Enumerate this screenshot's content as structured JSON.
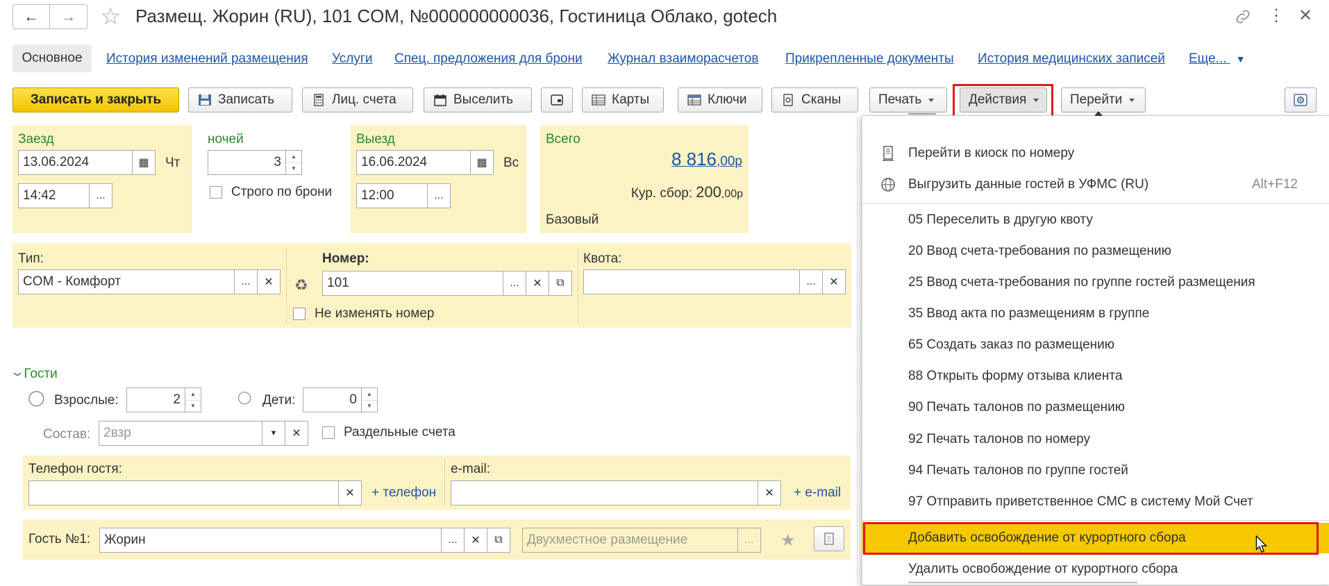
{
  "window": {
    "title": "Размещ. Жорин (RU), 101 COM, №000000000036, Гостиница Облако, gotech"
  },
  "tabs": [
    "Основное",
    "История изменений размещения",
    "Услуги",
    "Спец. предложения для брони",
    "Журнал взаиморасчетов",
    "Прикрепленные документы",
    "История медицинских записей",
    "Еще..."
  ],
  "toolbar": {
    "save_close": "Записать и закрыть",
    "save": "Записать",
    "accounts": "Лиц. счета",
    "checkout": "Выселить",
    "cards": "Карты",
    "keys": "Ключи",
    "scans": "Сканы",
    "print": "Печать",
    "actions": "Действия",
    "goto": "Перейти"
  },
  "checkin": {
    "label": "Заезд",
    "date": "13.06.2024",
    "weekday": "Чт",
    "time": "14:42"
  },
  "nights": {
    "label": "ночей",
    "value": "3",
    "strict_label": "Строго по брони"
  },
  "checkout": {
    "label": "Выезд",
    "date": "16.06.2024",
    "weekday": "Вс",
    "time": "12:00"
  },
  "total": {
    "label": "Всего",
    "amount_main": "8 816",
    "amount_frac": ",00р",
    "tax_label": "Кур. сбор:",
    "tax_main": "200",
    "tax_frac": ",00р",
    "rate": "Базовый"
  },
  "room": {
    "type_label": "Тип:",
    "type_value": "COM - Комфорт",
    "number_label": "Номер:",
    "number_value": "101",
    "no_change_label": "Не изменять номер",
    "quota_label": "Квота:",
    "quota_value": ""
  },
  "guests": {
    "section_label": "Гости",
    "adults_label": "Взрослые:",
    "adults_value": "2",
    "children_label": "Дети:",
    "children_value": "0",
    "composition_label": "Состав:",
    "composition_value": "2взр",
    "separate_label": "Раздельные счета",
    "phone_label": "Телефон гостя:",
    "phone_value": "",
    "add_phone": "+ телефон",
    "email_label": "e-mail:",
    "email_value": "",
    "add_email": "+ e-mail",
    "guest1_label": "Гость №1:",
    "guest1_value": "Жорин",
    "placement_placeholder": "Двухместное размещение"
  },
  "actions_menu": {
    "items": [
      {
        "label": "Перейти в киоск по номеру",
        "shortcut": "",
        "icon": "kiosk-icon"
      },
      {
        "label": "Выгрузить данные гостей в УФМС (RU)",
        "shortcut": "Alt+F12",
        "icon": "globe-upload-icon"
      },
      {
        "label": "05 Переселить в другую квоту",
        "shortcut": ""
      },
      {
        "label": "20 Ввод счета-требования по размещению",
        "shortcut": ""
      },
      {
        "label": "25 Ввод счета-требования по группе гостей размещения",
        "shortcut": ""
      },
      {
        "label": "35 Ввод акта по размещениям в группе",
        "shortcut": ""
      },
      {
        "label": "65 Создать заказ по размещению",
        "shortcut": ""
      },
      {
        "label": "88 Открыть форму отзыва клиента",
        "shortcut": ""
      },
      {
        "label": "90 Печать талонов по размещению",
        "shortcut": ""
      },
      {
        "label": "92 Печать талонов по номеру",
        "shortcut": ""
      },
      {
        "label": "94 Печать талонов по группе гостей",
        "shortcut": ""
      },
      {
        "label": "97 Отправить приветственное СМС в систему Мой Счет",
        "shortcut": ""
      },
      {
        "label": "Добавить освобождение от курортного сбора",
        "shortcut": ""
      },
      {
        "label": "Удалить освобождение от курортного сбора",
        "shortcut": ""
      }
    ]
  },
  "colors": {
    "accent_yellow": "#f5c800",
    "panel_yellow": "#fbf3c4",
    "link_blue": "#1f55a5",
    "label_green": "#2a8a2a",
    "highlight_red": "#e01818"
  }
}
